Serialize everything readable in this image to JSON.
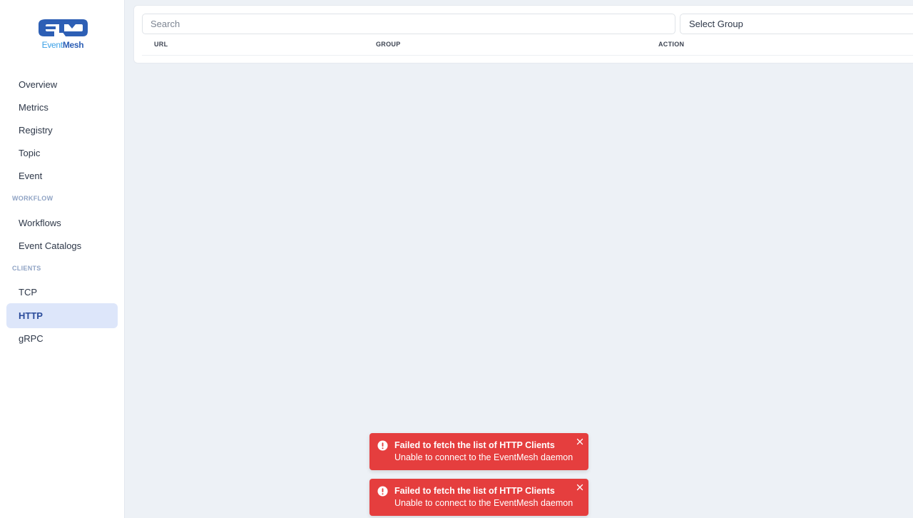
{
  "brand": {
    "name_part1": "Event",
    "name_part2": "Mesh"
  },
  "sidebar": {
    "items": [
      {
        "label": "Overview"
      },
      {
        "label": "Metrics"
      },
      {
        "label": "Registry"
      },
      {
        "label": "Topic"
      },
      {
        "label": "Event"
      }
    ],
    "sections": [
      {
        "label": "WORKFLOW",
        "items": [
          {
            "label": "Workflows"
          },
          {
            "label": "Event Catalogs"
          }
        ]
      },
      {
        "label": "CLIENTS",
        "items": [
          {
            "label": "TCP"
          },
          {
            "label": "HTTP",
            "active": true
          },
          {
            "label": "gRPC"
          }
        ]
      }
    ]
  },
  "main": {
    "search": {
      "placeholder": "Search",
      "value": ""
    },
    "group_select": {
      "value": "Select Group"
    },
    "table": {
      "columns": [
        "URL",
        "GROUP",
        "ACTION"
      ],
      "rows": []
    }
  },
  "toasts": [
    {
      "title": "Failed to fetch the list of HTTP Clients",
      "message": "Unable to connect to the EventMesh daemon",
      "icon": "error-icon"
    },
    {
      "title": "Failed to fetch the list of HTTP Clients",
      "message": "Unable to connect to the EventMesh daemon",
      "icon": "error-icon"
    }
  ],
  "colors": {
    "accent": "#2b4c9b",
    "active_bg": "#dde6fa",
    "toast_error": "#e53e3e",
    "page_bg": "#edf1f6"
  }
}
